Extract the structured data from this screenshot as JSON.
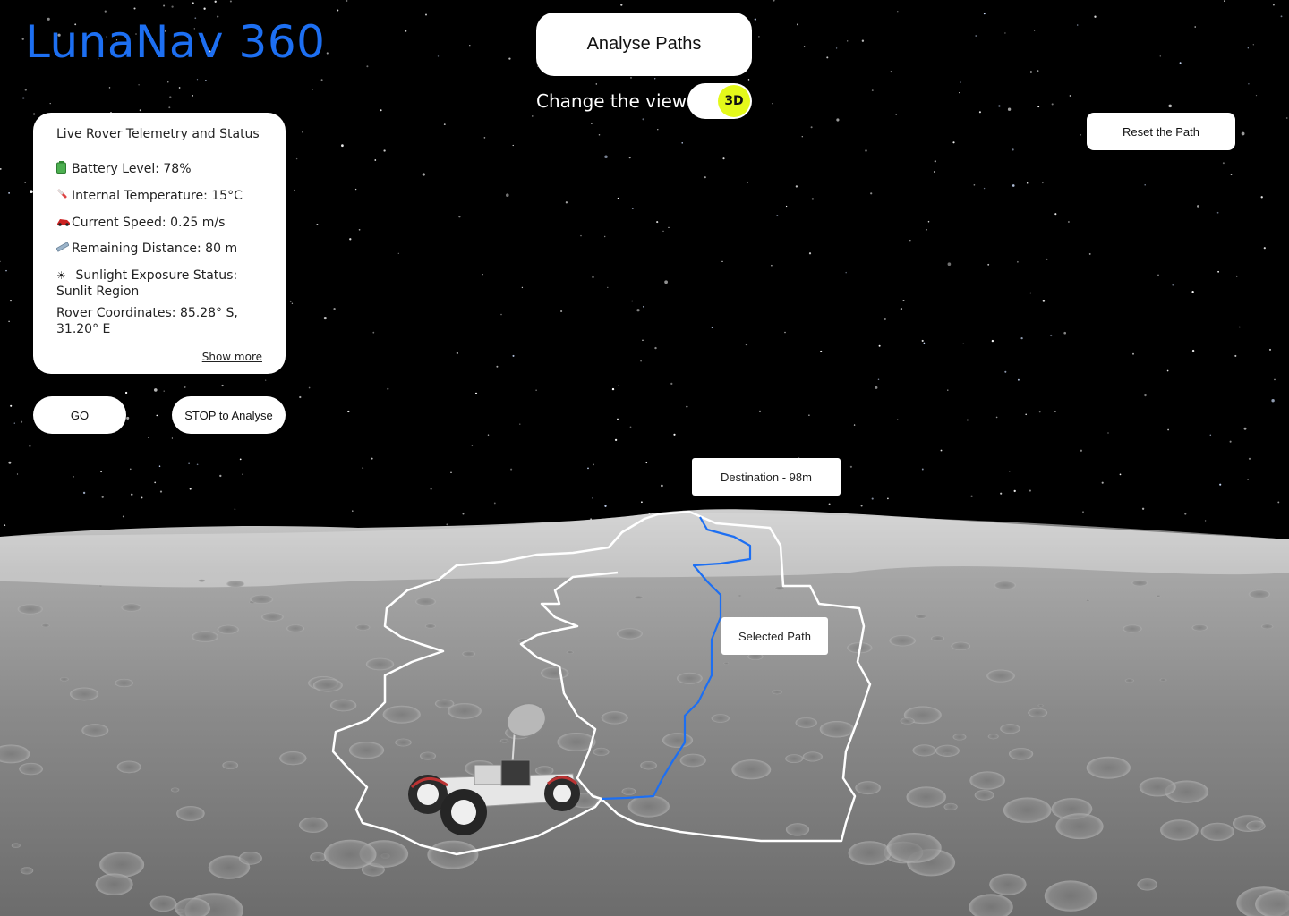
{
  "app": {
    "title": "LunaNav 360"
  },
  "controls": {
    "analyse_label": "Analyse Paths",
    "view_label": "Change the view",
    "view_mode": "3D",
    "reset_label": "Reset the Path",
    "go_label": "GO",
    "stop_label": "STOP to Analyse"
  },
  "telemetry": {
    "title": "Live Rover Telemetry and Status",
    "battery": "Battery Level: 78%",
    "temperature": "Internal Temperature: 15°C",
    "speed": "Current Speed: 0.25 m/s",
    "distance": "Remaining Distance: 80 m",
    "sunlight_label": "Sunlight Exposure Status:",
    "sunlight_value": "Sunlit Region",
    "coords_label": "Rover Coordinates: 85.28° S,",
    "coords_value": "31.20° E",
    "show_more": "Show more",
    "icons": [
      "battery-icon",
      "thermometer-icon",
      "speed-icon",
      "ruler-icon",
      "sun-icon"
    ]
  },
  "map": {
    "destination_label": "Destination - 98m",
    "selected_path_label": "Selected Path",
    "path_color": "#1d6ff2",
    "region_color": "#ffffff",
    "sky_color": "#000000",
    "terrain_color": "#8c8c8c"
  }
}
